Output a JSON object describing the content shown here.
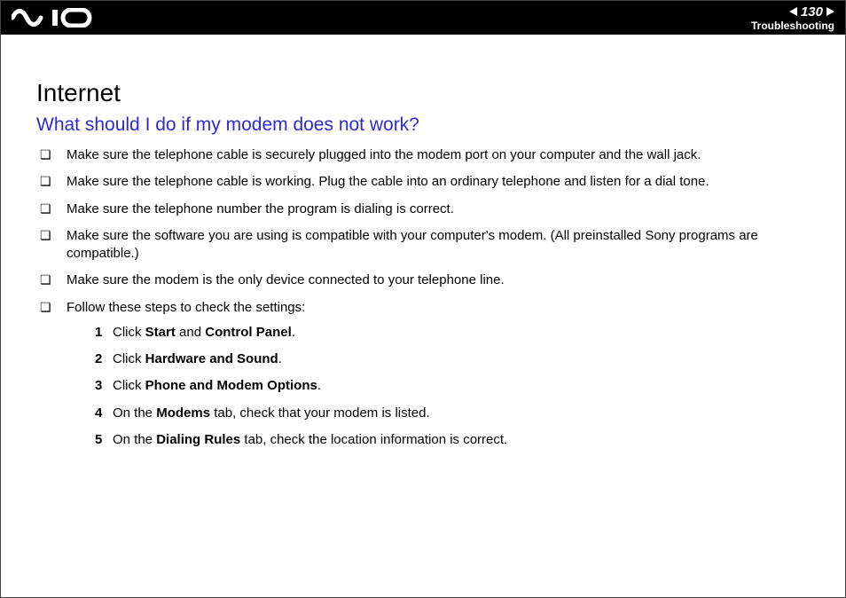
{
  "header": {
    "logo_name": "vaio-logo",
    "page_number": "130",
    "section": "Troubleshooting"
  },
  "title": "Internet",
  "question": "What should I do if my modem does not work?",
  "bullets": [
    "Make sure the telephone cable is securely plugged into the modem port on your computer and the wall jack.",
    "Make sure the telephone cable is working. Plug the cable into an ordinary telephone and listen for a dial tone.",
    "Make sure the telephone number the program is dialing is correct.",
    "Make sure the software you are using is compatible with your computer's modem. (All preinstalled Sony programs are compatible.)",
    "Make sure the modem is the only device connected to your telephone line.",
    "Follow these steps to check the settings:"
  ],
  "steps": [
    {
      "pre": "Click ",
      "b1": "Start",
      "mid": " and ",
      "b2": "Control Panel",
      "post": "."
    },
    {
      "pre": "Click ",
      "b1": "Hardware and Sound",
      "mid": "",
      "b2": "",
      "post": "."
    },
    {
      "pre": "Click ",
      "b1": "Phone and Modem Options",
      "mid": "",
      "b2": "",
      "post": "."
    },
    {
      "pre": "On the ",
      "b1": "Modems",
      "mid": " tab, check that your modem is listed.",
      "b2": "",
      "post": ""
    },
    {
      "pre": "On the ",
      "b1": "Dialing Rules",
      "mid": " tab, check the location information is correct.",
      "b2": "",
      "post": ""
    }
  ]
}
